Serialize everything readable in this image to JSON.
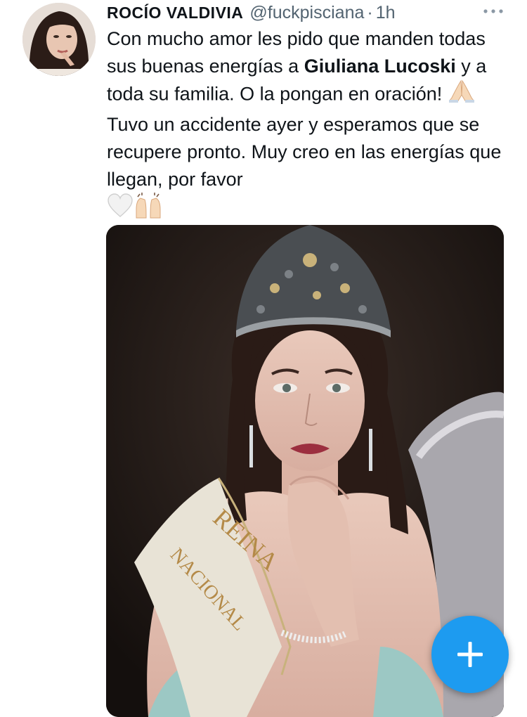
{
  "tweet": {
    "author_name": "ROCÍO VALDIVIA",
    "handle": "@fuckpisciana",
    "separator": "·",
    "time": "1h",
    "text": {
      "part1": "Con mucho amor les pido que manden todas sus buenas energías a ",
      "bold_name": "Giuliana Lucoski",
      "part2": " y a toda su familia. O la pongan en oración! ",
      "part3": " Tuvo un accidente ayer y esperamos que se recupere pronto. Muy creo en las energías que llegan, por favor"
    },
    "emojis": [
      "folded-hands",
      "white-heart",
      "raising-hands"
    ]
  },
  "media": {
    "sash_text_line1": "REINA",
    "sash_text_line2": "NACIONAL"
  },
  "colors": {
    "accent": "#1d9bf0",
    "secondary_text": "#536471",
    "primary_text": "#0f1419"
  },
  "icons": {
    "more": "more-options-icon",
    "compose": "plus-icon"
  }
}
